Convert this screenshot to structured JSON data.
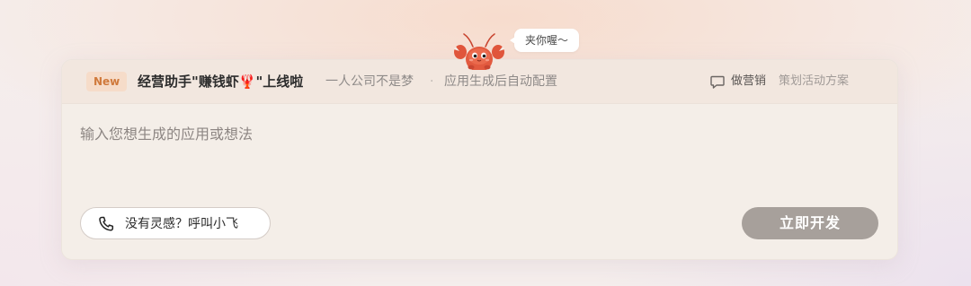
{
  "mascot": {
    "icon": "lobster-mascot-icon",
    "bubble_text": "夹你喔～"
  },
  "header": {
    "badge": "New",
    "title": "经营助手\"赚钱虾🦞\"上线啦",
    "tagline_1": "一人公司不是梦",
    "separator": "·",
    "tagline_2": "应用生成后自动配置",
    "marketing_icon": "chat-bubble-icon",
    "marketing_label": "做营销",
    "marketing_sub": "策划活动方案"
  },
  "input": {
    "placeholder": "输入您想生成的应用或想法",
    "value": ""
  },
  "idea_button": {
    "icon": "phone-icon",
    "label": "没有灵感？呼叫小飞"
  },
  "develop_button": {
    "label": "立即开发"
  },
  "colors": {
    "accent_badge_bg": "#f6dcc9",
    "accent_badge_text": "#d07a3c",
    "develop_button_bg": "#a7a09b",
    "mascot_red": "#e0553b"
  }
}
